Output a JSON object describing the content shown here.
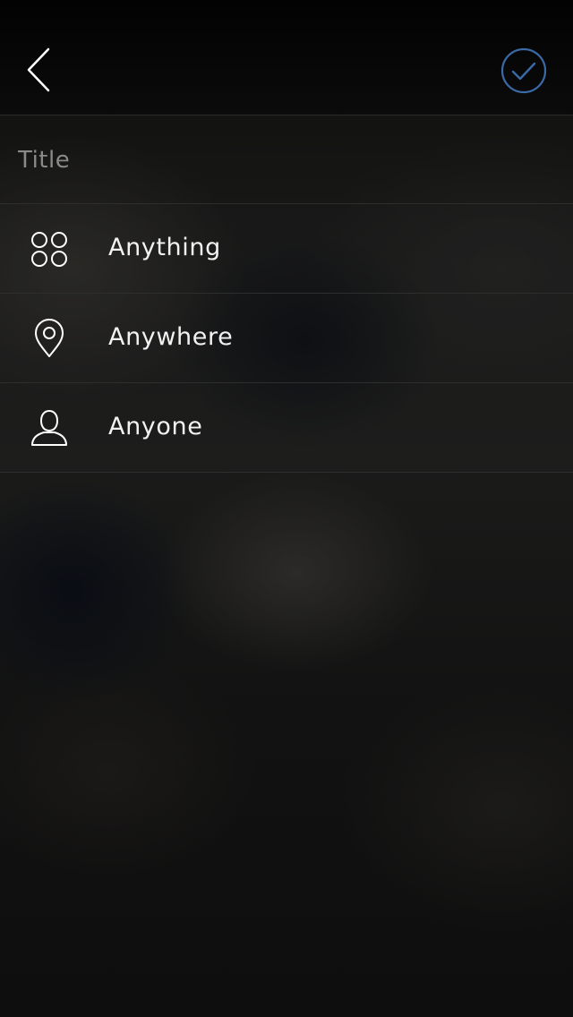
{
  "header": {
    "back_icon": "chevron-left-icon",
    "confirm_icon": "check-circle-icon",
    "confirm_color": "#3b6aa6"
  },
  "form": {
    "title_placeholder": "Title",
    "title_value": ""
  },
  "menu": {
    "items": [
      {
        "label": "Anything",
        "icon": "grid-four-circles-icon"
      },
      {
        "label": "Anywhere",
        "icon": "location-pin-icon"
      },
      {
        "label": "Anyone",
        "icon": "person-icon"
      }
    ]
  }
}
